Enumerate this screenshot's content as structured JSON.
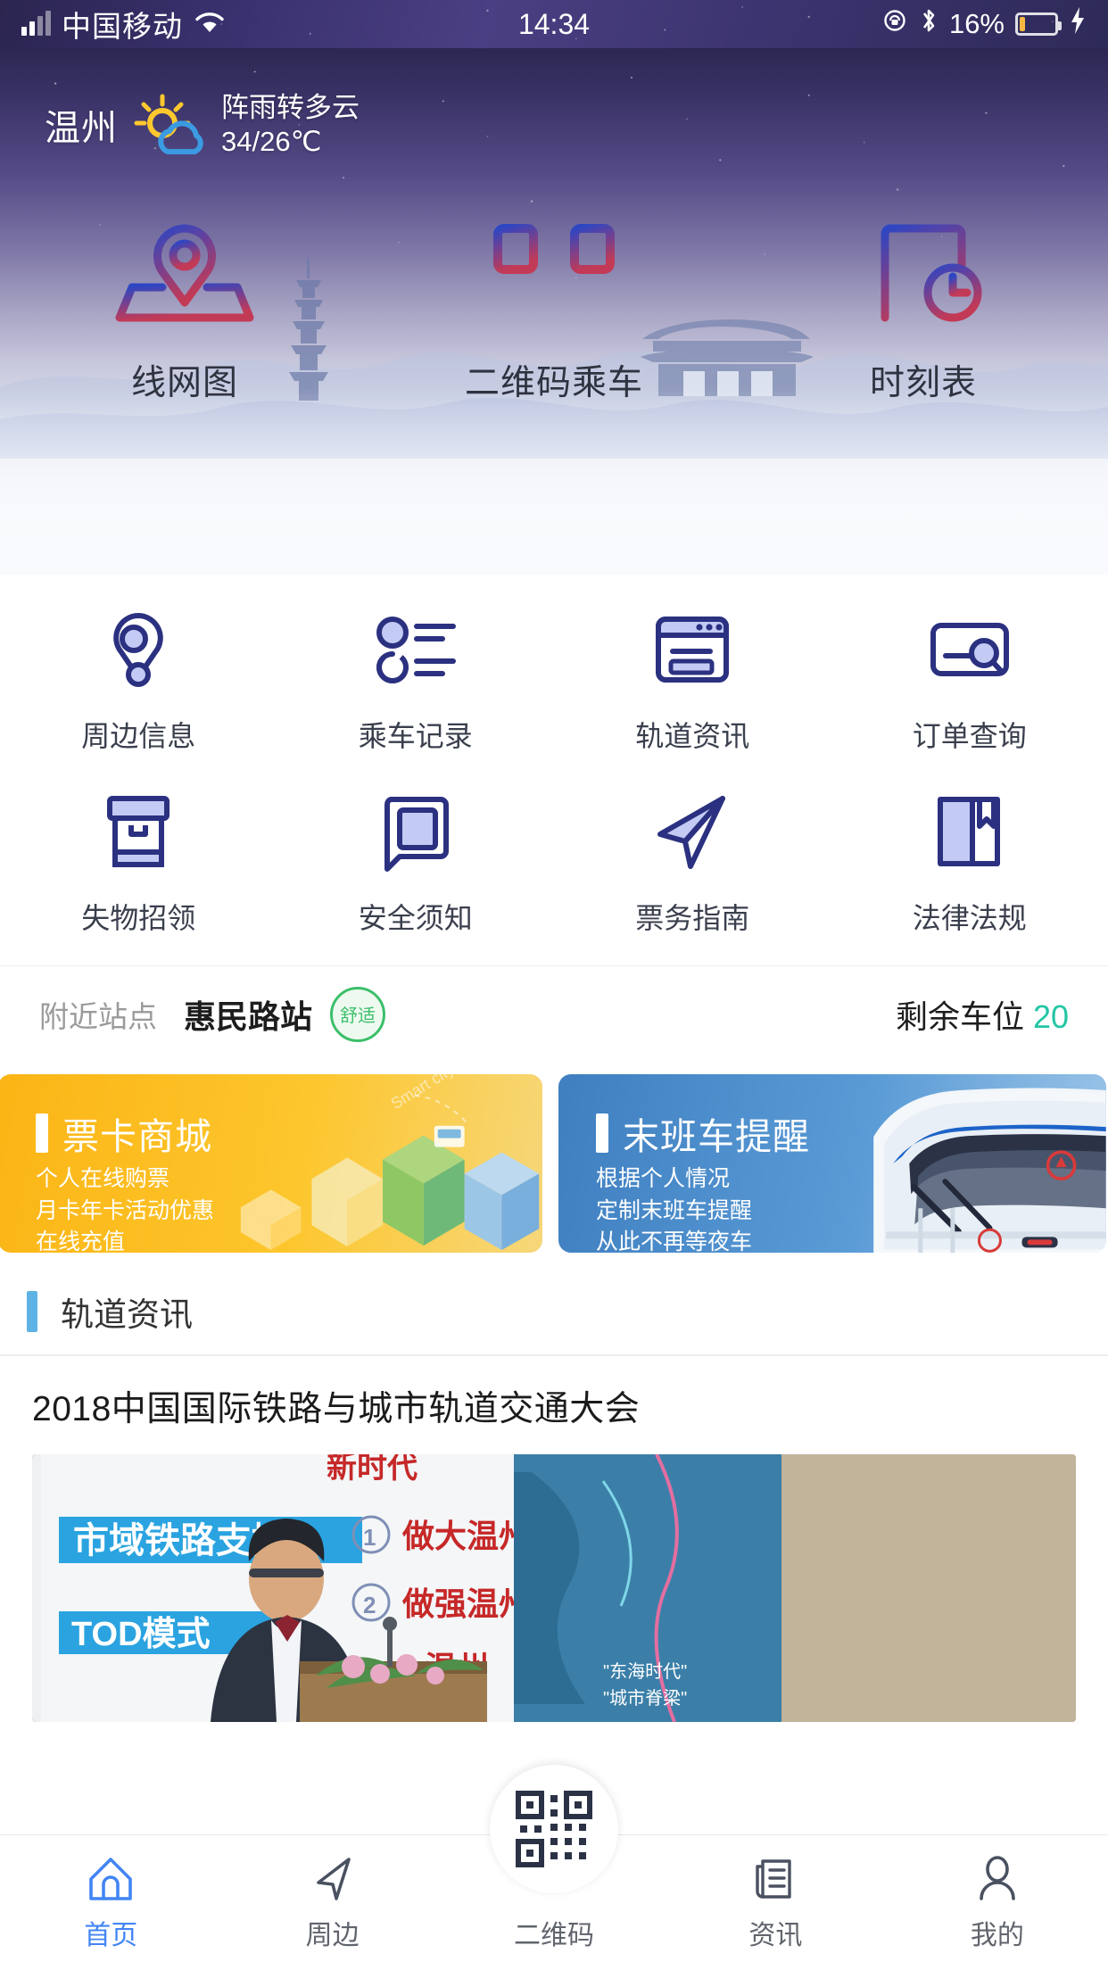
{
  "status_bar": {
    "carrier": "中国移动",
    "wifi_icon": "wifi-icon",
    "time": "14:34",
    "rotation_lock_icon": "rotation-lock-icon",
    "bluetooth_icon": "bluetooth-icon",
    "battery_percent": "16%",
    "charging_icon": "lightning-bolt-icon"
  },
  "weather": {
    "city": "温州",
    "icon": "sun-behind-cloud-icon",
    "condition": "阵雨转多云",
    "temperature": "34/26℃"
  },
  "top_nav": [
    {
      "label": "线网图",
      "icon": "map-pin-network-icon"
    },
    {
      "label": "二维码乘车",
      "icon": "qr-ride-icon"
    },
    {
      "label": "时刻表",
      "icon": "document-clock-icon"
    }
  ],
  "grid": [
    [
      {
        "label": "周边信息",
        "icon": "location-pin-search-icon"
      },
      {
        "label": "乘车记录",
        "icon": "list-record-icon"
      },
      {
        "label": "轨道资讯",
        "icon": "browser-news-icon"
      },
      {
        "label": "订单查询",
        "icon": "card-search-icon"
      }
    ],
    [
      {
        "label": "失物招领",
        "icon": "lost-found-box-icon"
      },
      {
        "label": "安全须知",
        "icon": "chat-bubble-icon"
      },
      {
        "label": "票务指南",
        "icon": "paper-plane-icon"
      },
      {
        "label": "法律法规",
        "icon": "open-book-icon"
      }
    ]
  ],
  "nearby": {
    "label": "附近站点",
    "station": "惠民路站",
    "comfort_badge": "舒适",
    "parking_label": "剩余车位",
    "parking_count": "20",
    "badge_color": "#3cbf6a",
    "count_color": "#23c6a5"
  },
  "promos": [
    {
      "title": "票卡商城",
      "lines": "个人在线购票\n月卡年卡活动优惠\n在线充值",
      "accent": "#fbb515",
      "art": "isometric-smart-city-illustration"
    },
    {
      "title": "末班车提醒",
      "lines": "根据个人情况\n定制末班车提醒\n从此不再等夜车",
      "accent": "#3f7fc0",
      "art": "metro-train-illustration"
    }
  ],
  "news": {
    "section_title": "轨道资讯",
    "section_bar_color": "#5eb3e4",
    "article_title": "2018中国国际铁路与城市轨道交通大会",
    "article_image": "conference-speaker-photo"
  },
  "tabbar": [
    {
      "label": "首页",
      "icon": "home-icon",
      "active": true
    },
    {
      "label": "周边",
      "icon": "navigation-arrow-icon",
      "active": false
    },
    {
      "label": "二维码",
      "icon": "qr-code-icon",
      "active": false
    },
    {
      "label": "资讯",
      "icon": "news-paper-icon",
      "active": false
    },
    {
      "label": "我的",
      "icon": "person-icon",
      "active": false
    }
  ],
  "theme": {
    "primary": "#4285f4",
    "icon_navy": "#2b3180",
    "icon_fill": "#c3cbf5"
  }
}
